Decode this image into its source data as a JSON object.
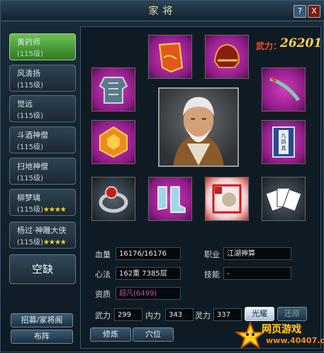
{
  "window": {
    "title": "家将",
    "help_label": "?",
    "close_label": "X"
  },
  "heroes": [
    {
      "name": "黄药师",
      "level": "(115级)",
      "stars": "",
      "active": true
    },
    {
      "name": "风清扬",
      "level": "(115级)",
      "stars": ""
    },
    {
      "name": "觉远",
      "level": "(115级)",
      "stars": ""
    },
    {
      "name": "斗酒神僧",
      "level": "(115级)",
      "stars": ""
    },
    {
      "name": "扫地神僧",
      "level": "(115级)",
      "stars": ""
    },
    {
      "name": "柳梦璃",
      "level": "(115级)",
      "stars": "★★★★"
    },
    {
      "name": "杨过·神雕大侠",
      "level": "(115级)",
      "stars": "★★★★"
    }
  ],
  "empty_slot_label": "空缺",
  "power": {
    "label": "武力：",
    "value": "26201"
  },
  "equipment": {
    "colors": {
      "magenta": "#c02ab0",
      "dark": "#2a333a"
    },
    "slots": [
      "cape",
      "helmet",
      "armor",
      "sword",
      "gem",
      "book",
      "ring",
      "boots",
      "card",
      "cards"
    ],
    "book_title": "九阴真经"
  },
  "stats": {
    "hp_label": "血量",
    "hp_value": "16176/16176",
    "job_label": "职业",
    "job_value": "江湖神算",
    "method_label": "心法",
    "method_value": "162重 7385层",
    "skill_label": "技能",
    "skill_value": "-",
    "quality_label": "资质",
    "quality_value": "超凡(6499)",
    "wuli_label": "武力",
    "wuli_value": "299",
    "neili_label": "内力",
    "neili_value": "343",
    "lingli_label": "灵力",
    "lingli_value": "337"
  },
  "buttons": {
    "illuminate": "光耀",
    "restore": "还原",
    "train": "修炼",
    "acupoint": "穴位",
    "recruit": "招募/家将阁",
    "formation": "布阵"
  },
  "watermark": {
    "text": "网页游戏",
    "url": "www.40407.com"
  }
}
